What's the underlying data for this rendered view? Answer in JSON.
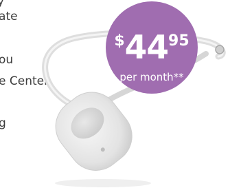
{
  "background_text": {
    "fragments": [
      "y",
      "ate",
      "ou",
      "e Center",
      "g"
    ]
  },
  "price_badge": {
    "currency": "$",
    "dollars": "44",
    "cents": "95",
    "period": "per month**",
    "color": "#a06db0"
  },
  "product_image": {
    "icon": "medical-alert-pendant-icon"
  }
}
